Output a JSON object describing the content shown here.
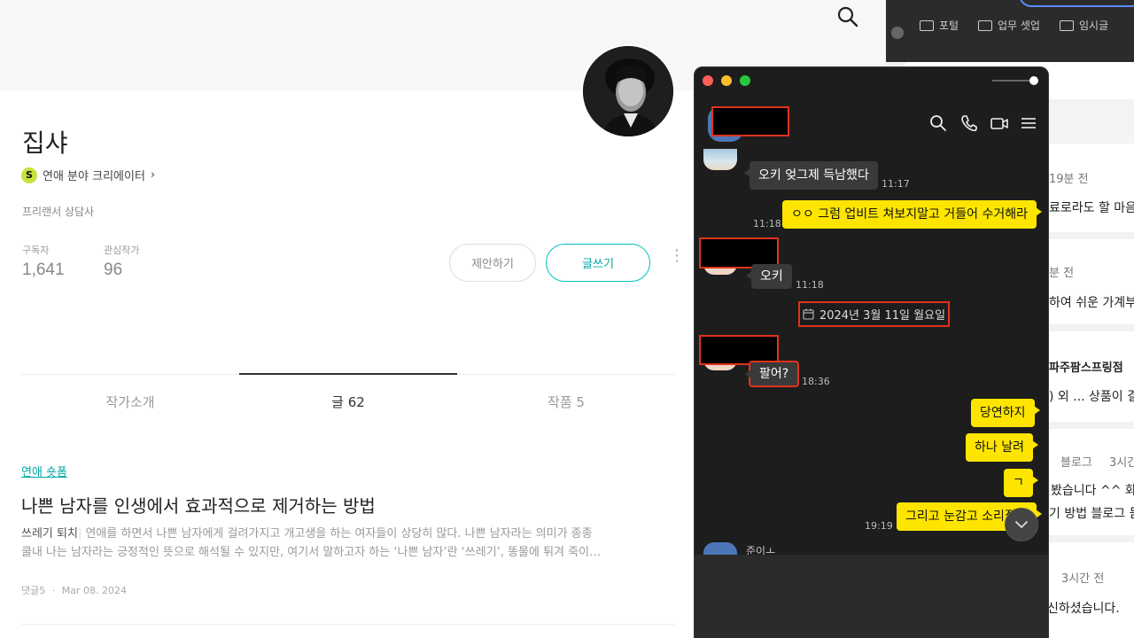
{
  "profile": {
    "name": "집샤",
    "creator_badge_letter": "S",
    "creator_badge": "연애 분야 크리에이터",
    "creator_chevron": "›",
    "job": "프리랜서 상담사",
    "subscribers_label": "구독자",
    "subscribers_value": "1,641",
    "following_label": "관심작가",
    "following_value": "96",
    "propose_button": "제안하기",
    "write_button": "글쓰기",
    "more_icon": "⋮"
  },
  "tabs": [
    {
      "label": "작가소개"
    },
    {
      "label": "글 62"
    },
    {
      "label": "작품 5"
    }
  ],
  "post": {
    "category": "연애 숏폼",
    "title": "나쁜 남자를 인생에서 효과적으로 제거하는 방법",
    "excerpt_lead": "쓰레기 퇴치",
    "excerpt_sep": "|",
    "excerpt_line1": " 연애를 하면서 나쁜 남자에게 걸려가지고 개고생을 하는 여자들이 상당히 많다. 나쁜 남자라는 의미가 종종",
    "excerpt_line2": "쿨내 나는 남자라는 긍정적인 뜻으로 해석될 수 있지만, 여기서 말하고자 하는 ‘나쁜 남자’란 ‘쓰레기’, 똥물에 튀겨 죽이…",
    "comments": "댓글5",
    "meta_sep": "·",
    "date": "Mar 08. 2024"
  },
  "background_window": {
    "bookmarks": [
      {
        "label": "포털"
      },
      {
        "label": "업무 셋업"
      },
      {
        "label": "임시글"
      }
    ],
    "lines": {
      "l1": "19분 전",
      "l2": "료로라도 할 마음",
      "l3": "분 전",
      "l4": "하여 쉬운 가계부",
      "l5": "파주팜스프링점",
      "l6": ") 외 ... 상품이 결",
      "l7": "블로그",
      "l8": "3시간",
      "l9": "봤습니다 ^^ 화",
      "l10": "기 방법 블로그 듣",
      "l11": "3시간 전",
      "l12": "신하셨습니다."
    }
  },
  "chat": {
    "messages": [
      {
        "text": "오키 엊그제 득남했다",
        "time": "11:17"
      },
      {
        "text": "ㅇㅇ 그럼 업비트 쳐보지말고 거들어 수거해라",
        "time": "11:18"
      },
      {
        "text": "오키",
        "time": "11:18"
      },
      {
        "text": "팔어?",
        "time": "18:36"
      },
      {
        "text": "당연하지"
      },
      {
        "text": "하나 날려"
      },
      {
        "text": "ㄱ"
      },
      {
        "text": "그리고 눈감고 소리질러",
        "time": "19:19"
      }
    ],
    "date_separator": "2024년 3월 11일 월요일",
    "next_sender_partial": "준이ㅗ"
  },
  "colors": {
    "accent_teal": "#00c3bd",
    "kakao_yellow": "#fee500",
    "redaction_border": "#e0331b",
    "chat_bg": "#1d1d1d"
  }
}
